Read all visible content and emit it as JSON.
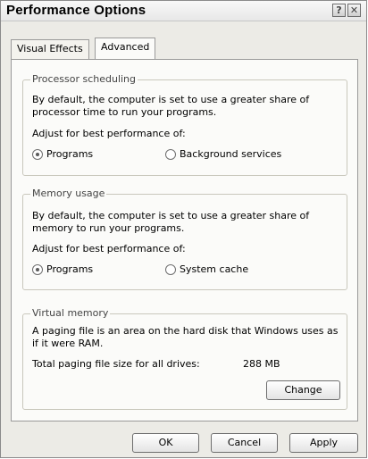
{
  "window": {
    "title": "Performance Options",
    "help_glyph": "?",
    "close_glyph": "✕"
  },
  "tabs": [
    {
      "label": "Visual Effects",
      "active": false
    },
    {
      "label": "Advanced",
      "active": true
    }
  ],
  "processor": {
    "legend": "Processor scheduling",
    "desc_line1": "By default, the computer is set to use a greater share of",
    "desc_line2": "processor time to run your programs.",
    "adjust_label": "Adjust for best performance of:",
    "options": [
      {
        "label": "Programs",
        "selected": true
      },
      {
        "label": "Background services",
        "selected": false
      }
    ]
  },
  "memory": {
    "legend": "Memory usage",
    "desc_line1": "By default, the computer is set to use a greater share of",
    "desc_line2": "memory to run your programs.",
    "adjust_label": "Adjust for best performance of:",
    "options": [
      {
        "label": "Programs",
        "selected": true
      },
      {
        "label": "System cache",
        "selected": false
      }
    ]
  },
  "virtual": {
    "legend": "Virtual memory",
    "desc_line1": "A paging file is an area on the hard disk that Windows uses as",
    "desc_line2": "if it were RAM.",
    "total_label": "Total paging file size for all drives:",
    "total_value": "288 MB",
    "change_label": "Change"
  },
  "footer": {
    "ok_label": "OK",
    "cancel_label": "Cancel",
    "apply_label": "Apply"
  }
}
